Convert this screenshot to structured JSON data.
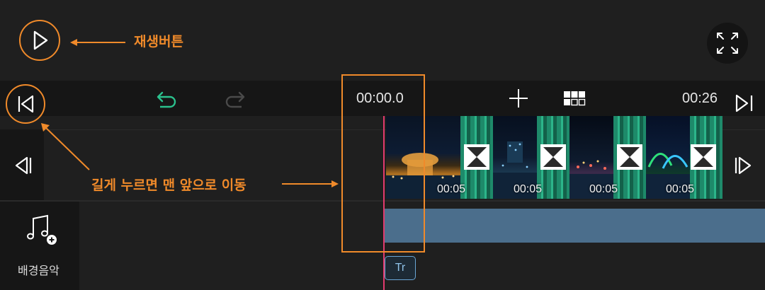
{
  "annotations": {
    "play_button": "재생버튼",
    "long_press": "길게 누르면 맨 앞으로 이동"
  },
  "toolbar": {
    "current_time": "00:00.0",
    "total_time": "00:26"
  },
  "clips": [
    {
      "duration": "00:05"
    },
    {
      "duration": "00:05"
    },
    {
      "duration": "00:05"
    },
    {
      "duration": "00:05"
    }
  ],
  "audio": {
    "add_music_label": "배경음악"
  },
  "text_track": {
    "chip_label": "Tr"
  },
  "colors": {
    "accent_orange": "#f08a2a",
    "undo_green": "#2bc18d",
    "playhead": "#e23a6e",
    "audio_track": "#4b6e8c"
  },
  "icons": [
    "play-icon",
    "fullscreen-icon",
    "skip-to-start-icon",
    "undo-icon",
    "redo-icon",
    "add-icon",
    "grid-icon",
    "skip-to-end-icon",
    "prev-frame-icon",
    "next-frame-icon",
    "music-add-icon"
  ]
}
